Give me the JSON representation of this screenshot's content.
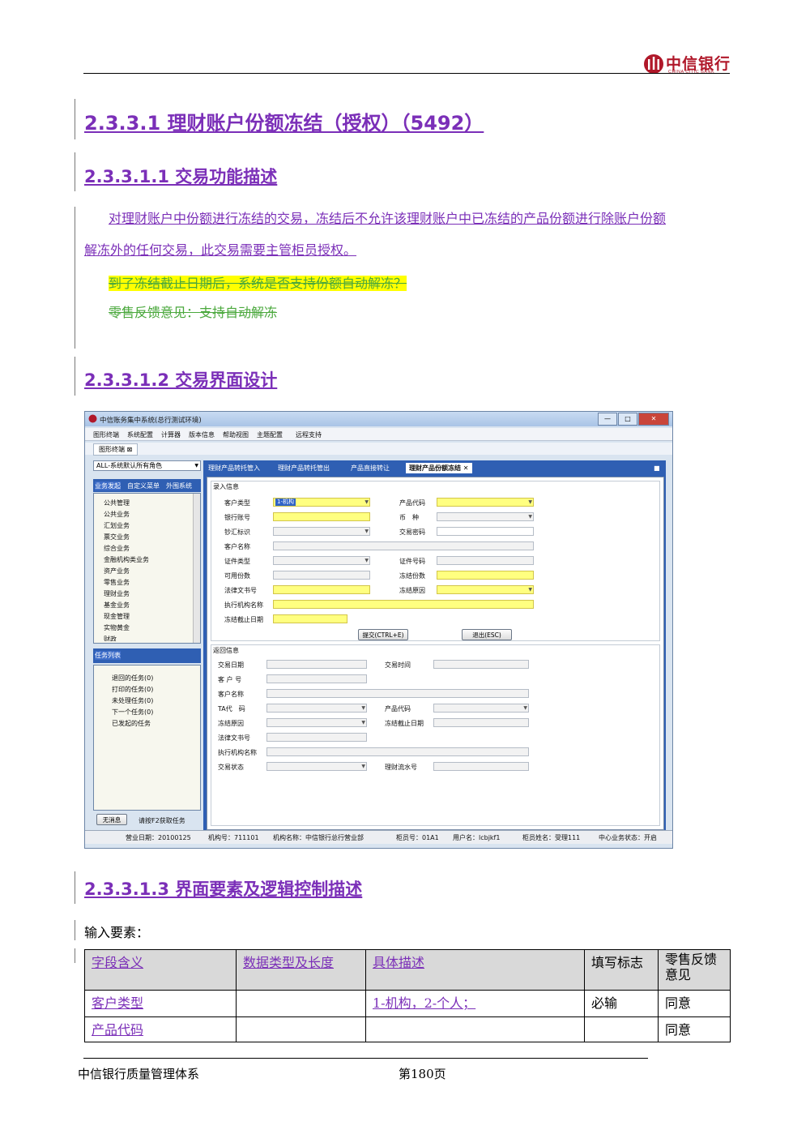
{
  "header": {
    "logo_cn": "中信银行",
    "logo_en": "CHINA CITIC BANK"
  },
  "section_title": "2.3.3.1 理财账户份额冻结（授权）（5492）",
  "sub1": {
    "title": "2.3.3.1.1 交易功能描述",
    "para_line1": "对理财账户中份额进行冻结的交易，冻结后不允许该理财账户中已冻结的产品份额进行除账户份额",
    "para_line2": "解冻外的任何交易，此交易需要主管柜员授权。",
    "question": "到了冻结截止日期后，系统是否支持份额自动解冻？",
    "feedback": "零售反馈意见：支持自动解冻"
  },
  "sub2": {
    "title": "2.3.3.1.2 交易界面设计"
  },
  "app": {
    "title": "中信账务集中系统(总行测试环境)",
    "menu": [
      "图形终端",
      "系统配置",
      "计算器",
      "版本信息",
      "帮助视图",
      "主题配置",
      "远程支持"
    ],
    "tab": "图形终端",
    "role": "ALL-系统默认所有角色",
    "left_tabs": [
      "业务发起",
      "自定义菜单",
      "外围系统"
    ],
    "tree": [
      "公共管理",
      "公共业务",
      "汇划业务",
      "票交业务",
      "综合业务",
      "金融机构类业务",
      "资产业务",
      "零售业务",
      "理财业务",
      "基金业务",
      "现金管理",
      "实物黄金",
      "财政"
    ],
    "task_header": "任务列表",
    "tasks": [
      "退回的任务(0)",
      "打印的任务(0)",
      "未处理任务(0)",
      "下一个任务(0)",
      "已发起的任务"
    ],
    "bottom_btn": "无消息",
    "bottom_hint": "请按F2获取任务",
    "right_tabs": [
      "理财产品转托管入",
      "理财产品转托管出",
      "产品直接转让",
      "理财产品份额冻结"
    ],
    "input_group": "录入信息",
    "input_labels": [
      "客户类型",
      "产品代码",
      "银行账号",
      "币　种",
      "钞汇标识",
      "交易密码",
      "客户名称",
      "证件类型",
      "证件号码",
      "可用份数",
      "冻结份数",
      "法律文书号",
      "冻结原因",
      "执行机构名称",
      "冻结截止日期"
    ],
    "customer_type_value": "1-机构",
    "submit_btn": "提交(CTRL+E)",
    "exit_btn": "退出(ESC)",
    "return_group": "返回信息",
    "return_labels": [
      "交易日期",
      "交易时间",
      "客 户 号",
      "客户名称",
      "TA代　码",
      "产品代码",
      "冻结原因",
      "冻结截止日期",
      "法律文书号",
      "执行机构名称",
      "交易状态",
      "理财流水号"
    ],
    "status": [
      "营业日期：20100125",
      "机构号：711101",
      "机构名称：中信银行总行营业部",
      "柜员号：01A1",
      "用户名：lcbjkf1",
      "柜员姓名：受理111",
      "中心业务状态：开启"
    ]
  },
  "sub3": {
    "title": "2.3.3.1.3 界面要素及逻辑控制描述",
    "input_label": "输入要素："
  },
  "table": {
    "headers": [
      "字段含义",
      "数据类型及长度",
      "具体描述",
      "填写标志",
      "零售反馈意见"
    ],
    "rows": [
      [
        "客户类型",
        "",
        "1-机构，2-个人；",
        "必输",
        "同意"
      ],
      [
        "产品代码",
        "",
        "",
        "",
        "同意"
      ]
    ]
  },
  "footer": {
    "left": "中信银行质量管理体系",
    "page": "第180页"
  },
  "colors": {
    "heading": "#7b2fb8",
    "highlight": "#ffff00",
    "strike": "#4aa83c",
    "brand": "#b0182a"
  }
}
